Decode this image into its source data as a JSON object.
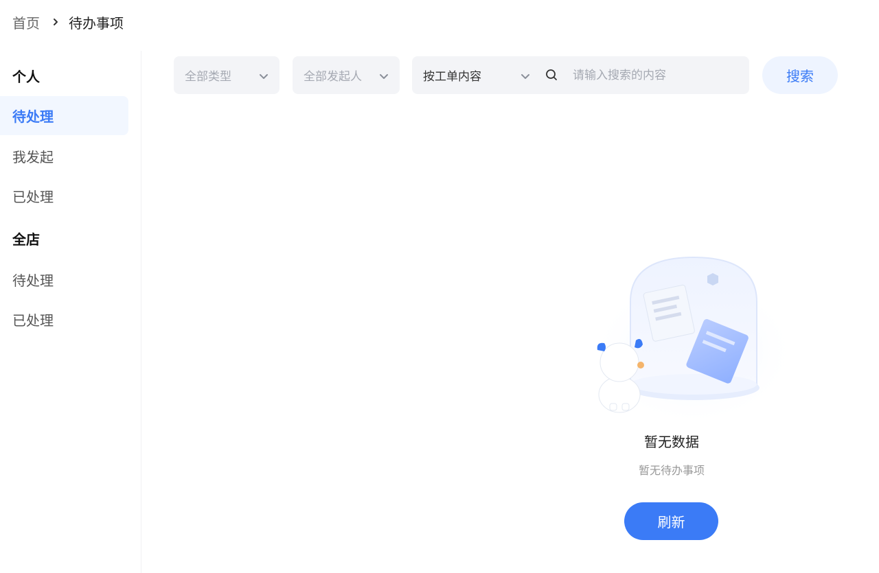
{
  "breadcrumb": {
    "home": "首页",
    "current": "待办事项"
  },
  "sidebar": {
    "personal_title": "个人",
    "personal_items": [
      "待处理",
      "我发起",
      "已处理"
    ],
    "store_title": "全店",
    "store_items": [
      "待处理",
      "已处理"
    ],
    "active_item": "个人/待处理"
  },
  "filters": {
    "type_select": "全部类型",
    "initiator_select": "全部发起人",
    "search_mode": "按工单内容",
    "search_placeholder": "请输入搜索的内容",
    "search_button": "搜索"
  },
  "empty_state": {
    "title": "暂无数据",
    "subtitle": "暂无待办事项",
    "refresh_button": "刷新"
  },
  "colors": {
    "accent": "#3b7bf6",
    "active_bg": "#f2f7ff",
    "input_bg": "#f3f4f7"
  },
  "icons": {
    "separator": "chevron-right-icon",
    "dropdown": "chevron-down-icon",
    "search": "search-icon"
  }
}
